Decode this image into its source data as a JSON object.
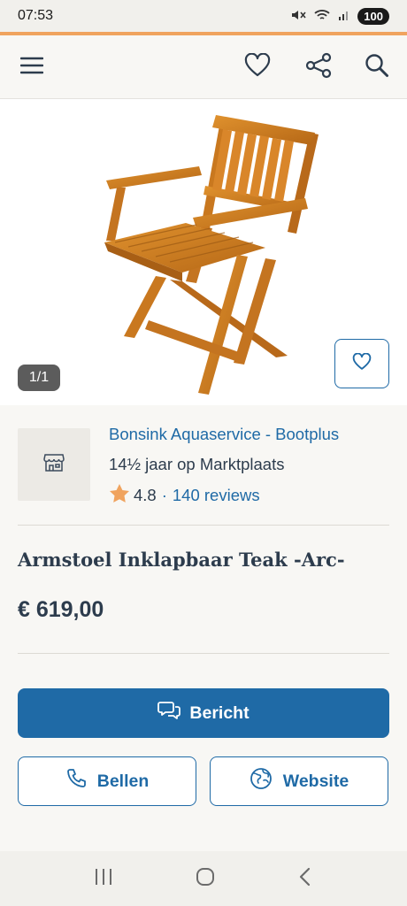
{
  "status_bar": {
    "time": "07:53",
    "battery": "100"
  },
  "colors": {
    "accent": "#f0a35e",
    "primary": "#1f6aa6",
    "text": "#2d3c4d",
    "star": "#f0a35e"
  },
  "nav": {
    "icons": [
      "menu-icon",
      "heart-icon",
      "share-icon",
      "search-icon"
    ]
  },
  "gallery": {
    "counter": "1/1"
  },
  "seller": {
    "name": "Bonsink Aquaservice - Bootplus",
    "since": "14½ jaar op Marktplaats",
    "rating": "4.8",
    "separator": "·",
    "reviews": "140 reviews"
  },
  "listing": {
    "title": "Armstoel Inklapbaar Teak -Arc-",
    "price": "€ 619,00"
  },
  "actions": {
    "message": "Bericht",
    "call": "Bellen",
    "website": "Website"
  }
}
